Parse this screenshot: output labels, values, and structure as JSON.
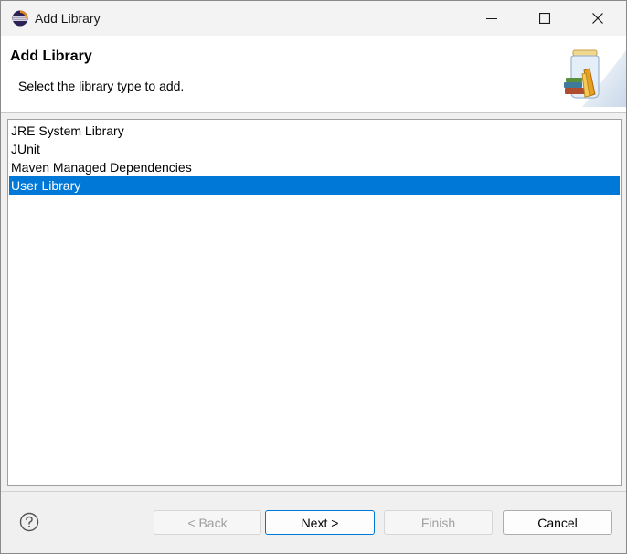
{
  "window": {
    "title": "Add Library"
  },
  "banner": {
    "title": "Add Library",
    "description": "Select the library type to add."
  },
  "library_list": {
    "items": [
      {
        "label": "JRE System Library",
        "selected": false
      },
      {
        "label": "JUnit",
        "selected": false
      },
      {
        "label": "Maven Managed Dependencies",
        "selected": false
      },
      {
        "label": "User Library",
        "selected": true
      }
    ]
  },
  "buttons": {
    "back": "< Back",
    "next": "Next >",
    "finish": "Finish",
    "cancel": "Cancel"
  },
  "icons": {
    "app": "eclipse-icon",
    "help": "help-icon",
    "banner": "library-jar-icon"
  },
  "colors": {
    "selection": "#0078d7",
    "default_button_border": "#0078d7"
  }
}
